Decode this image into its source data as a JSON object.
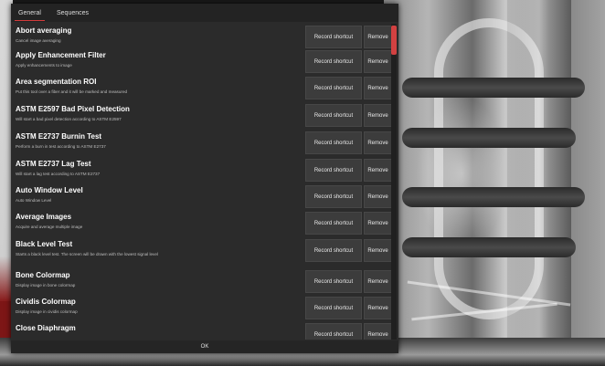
{
  "tabs": [
    "General",
    "Sequences"
  ],
  "buttons": {
    "record": "Record shortcut",
    "remove": "Remove",
    "ok": "OK"
  },
  "items": [
    {
      "title": "Abort averaging",
      "desc": "Cancel image averaging"
    },
    {
      "title": "Apply Enhancement Filter",
      "desc": "Apply enhancements to image"
    },
    {
      "title": "Area segmentation ROI",
      "desc": "Put this tool over a fiber and it will be marked and measured"
    },
    {
      "title": "ASTM E2597 Bad Pixel Detection",
      "desc": "Will start a bad pixel detection according to ASTM E2597"
    },
    {
      "title": "ASTM E2737 Burnin Test",
      "desc": "Perform a burn in test according to ASTM E2737"
    },
    {
      "title": "ASTM E2737 Lag Test",
      "desc": "Will start a lag test according to ASTM E2737"
    },
    {
      "title": "Auto Window Level",
      "desc": "Auto Window Level"
    },
    {
      "title": "Average Images",
      "desc": "Acquire and average multiple image"
    },
    {
      "title": "Black Level Test",
      "desc": "Starts a black level test. The screen will be drawn with the lowest signal level"
    },
    {
      "title": "Bone Colormap",
      "desc": "Display image in bone colormap"
    },
    {
      "title": "Cividis Colormap",
      "desc": "Display image in cividis colormap"
    },
    {
      "title": "Close Diaphragm",
      "desc": ""
    }
  ]
}
